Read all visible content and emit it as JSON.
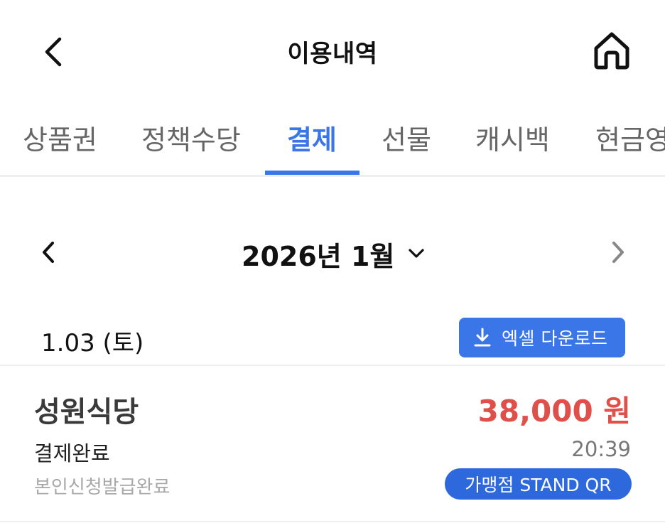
{
  "header": {
    "title": "이용내역",
    "back_icon": "chevron-left-icon",
    "home_icon": "home-icon"
  },
  "tabs": [
    {
      "label": "상품권",
      "active": false
    },
    {
      "label": "정책수당",
      "active": false
    },
    {
      "label": "결제",
      "active": true
    },
    {
      "label": "선물",
      "active": false
    },
    {
      "label": "캐시백",
      "active": false
    },
    {
      "label": "현금영",
      "active": false
    }
  ],
  "month_nav": {
    "label": "2026년 1월",
    "prev_icon": "chevron-left-icon",
    "next_icon": "chevron-right-icon",
    "dropdown_icon": "chevron-down-icon"
  },
  "date_group": {
    "date": "1.03 (토)",
    "excel_button": "엑셀 다운로드",
    "excel_icon": "download-icon"
  },
  "transaction": {
    "merchant": "성원식당",
    "amount": "38,000 원",
    "status": "결제완료",
    "time": "20:39",
    "sub_status": "본인신청발급완료",
    "badge": "가맹점 STAND QR"
  },
  "colors": {
    "accent": "#3b76e8",
    "amount": "#e0504a",
    "badge": "#2d69dd"
  }
}
